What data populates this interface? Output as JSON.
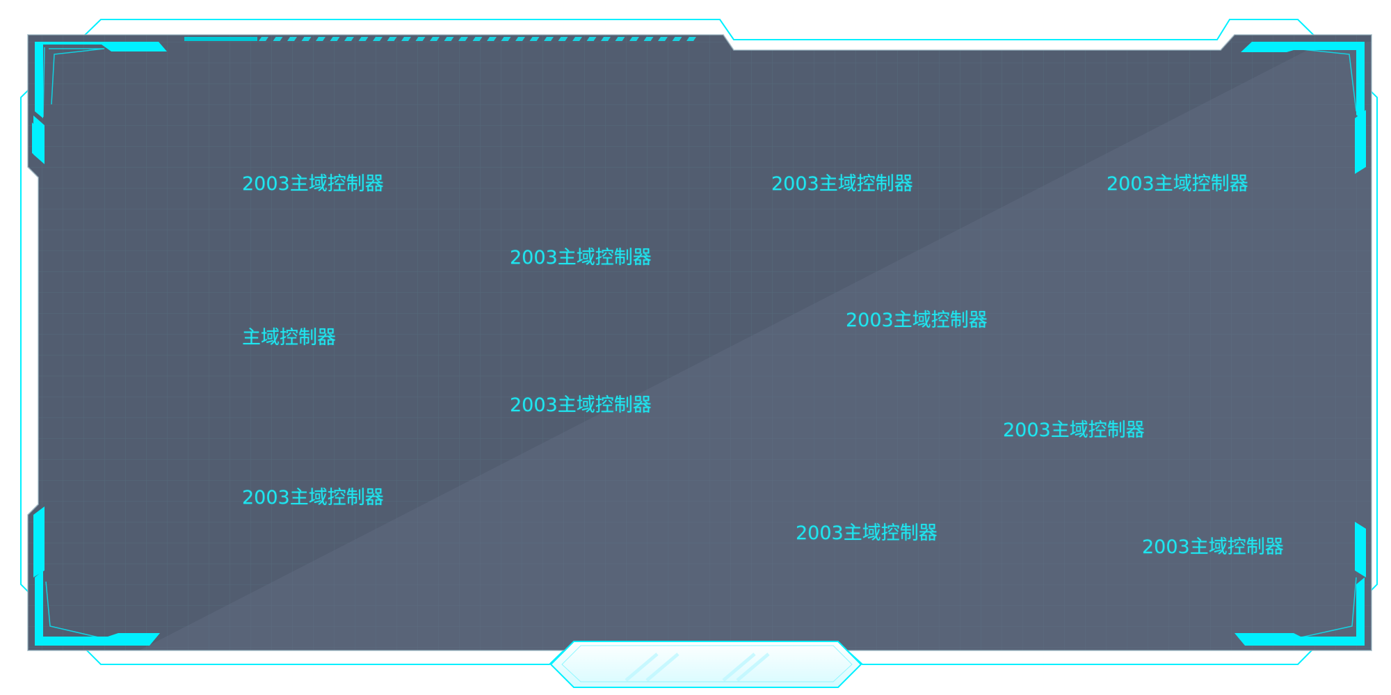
{
  "colors": {
    "accent": "#00f0ff",
    "panel_bg": "#525d70",
    "grid": "#5f7a8a",
    "label": "#1fe6f0"
  },
  "labels": [
    {
      "id": "n1",
      "text": "2003主域控制器"
    },
    {
      "id": "n2",
      "text": "2003主域控制器"
    },
    {
      "id": "n3",
      "text": "2003主域控制器"
    },
    {
      "id": "n4",
      "text": "2003主域控制器"
    },
    {
      "id": "n5",
      "text": "2003主域控制器"
    },
    {
      "id": "n6",
      "text": "主域控制器"
    },
    {
      "id": "n7",
      "text": "2003主域控制器"
    },
    {
      "id": "n8",
      "text": "2003主域控制器"
    },
    {
      "id": "n9",
      "text": "2003主域控制器"
    },
    {
      "id": "n10",
      "text": "2003主域控制器"
    },
    {
      "id": "n11",
      "text": "2003主域控制器"
    }
  ]
}
